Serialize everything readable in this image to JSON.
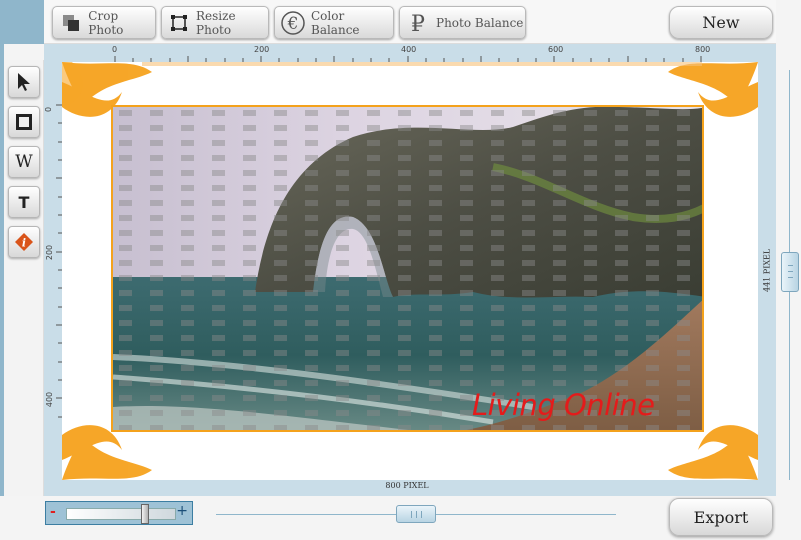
{
  "toolbar": {
    "crop_label": "Crop Photo",
    "resize_label": "Resize Photo",
    "color_label": "Color Balance",
    "photo_label": "Photo Balance",
    "new_label": "New"
  },
  "tools": [
    {
      "name": "pointer",
      "icon": "arrow-pointer-icon"
    },
    {
      "name": "rectangle",
      "icon": "square-icon"
    },
    {
      "name": "w",
      "label": "W"
    },
    {
      "name": "text",
      "label": "T"
    },
    {
      "name": "info",
      "icon": "info-icon"
    }
  ],
  "ruler": {
    "top_ticks": [
      "0",
      "200",
      "400",
      "600",
      "800"
    ],
    "left_ticks": [
      "0",
      "200",
      "400"
    ],
    "width_label": "800 PIXEL",
    "height_label": "441 PIXEL"
  },
  "canvas": {
    "watermark": "Living Online",
    "accent_color": "#f4a21c",
    "watermark_color": "#e41b1b"
  },
  "zoom": {
    "minus": "-",
    "plus": "+"
  },
  "footer": {
    "export_label": "Export"
  }
}
